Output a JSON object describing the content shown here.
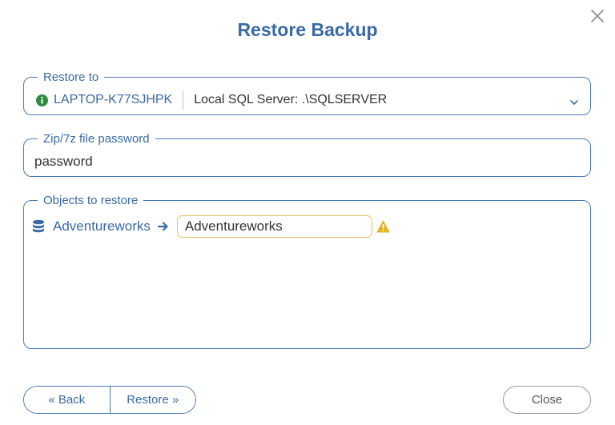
{
  "dialog": {
    "title": "Restore Backup",
    "close_icon": "close-icon"
  },
  "restore_to": {
    "legend": "Restore to",
    "host": "LAPTOP-K77SJHPK",
    "server": "Local SQL Server: .\\SQLSERVER",
    "icons": {
      "info": "info-circle-icon",
      "dropdown": "chevron-down-icon"
    },
    "info_color": "#2e8b3e"
  },
  "zip_password": {
    "legend": "Zip/7z file password",
    "value": "password"
  },
  "objects": {
    "legend": "Objects to restore",
    "items": [
      {
        "source": "Adventureworks",
        "target": "Adventureworks",
        "icons": {
          "source": "database-icon",
          "arrow": "arrow-right-icon",
          "status": "warning-icon"
        },
        "warning_color": "#e6b325"
      }
    ]
  },
  "footer": {
    "back_label": "« Back",
    "restore_label": "Restore »",
    "close_label": "Close"
  },
  "colors": {
    "accent": "#3a6aa5",
    "border": "#4a7ab8",
    "warning_border": "#e6c15a"
  }
}
